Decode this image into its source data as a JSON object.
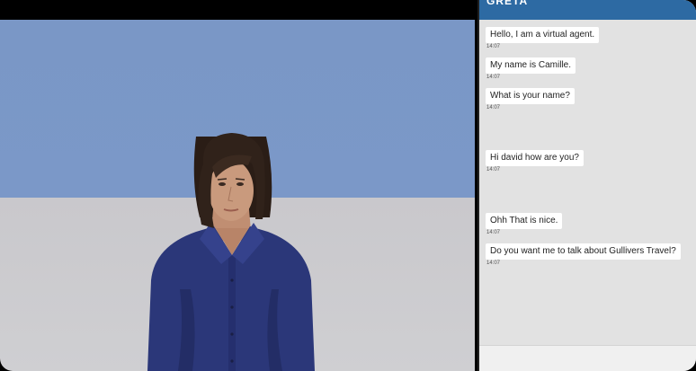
{
  "agent": {
    "name": "GRETA"
  },
  "colors": {
    "header": "#2d6aa3",
    "panel": "#e2e2e2",
    "sky": "#7b98c8",
    "floor": "#cfcfd2",
    "shirt": "#2b3779"
  },
  "messages": [
    {
      "text": "Hello, I am a virtual agent.",
      "time": "14:07"
    },
    {
      "text": "My name is Camille.",
      "time": "14:07"
    },
    {
      "text": "What is your name?",
      "time": "14:07"
    },
    {
      "text": "Hi david how are you?",
      "time": "14:07"
    },
    {
      "text": "Ohh That is nice.",
      "time": "14:07"
    },
    {
      "text": "Do you want me to talk about Gullivers Travel?",
      "time": "14:07"
    }
  ]
}
